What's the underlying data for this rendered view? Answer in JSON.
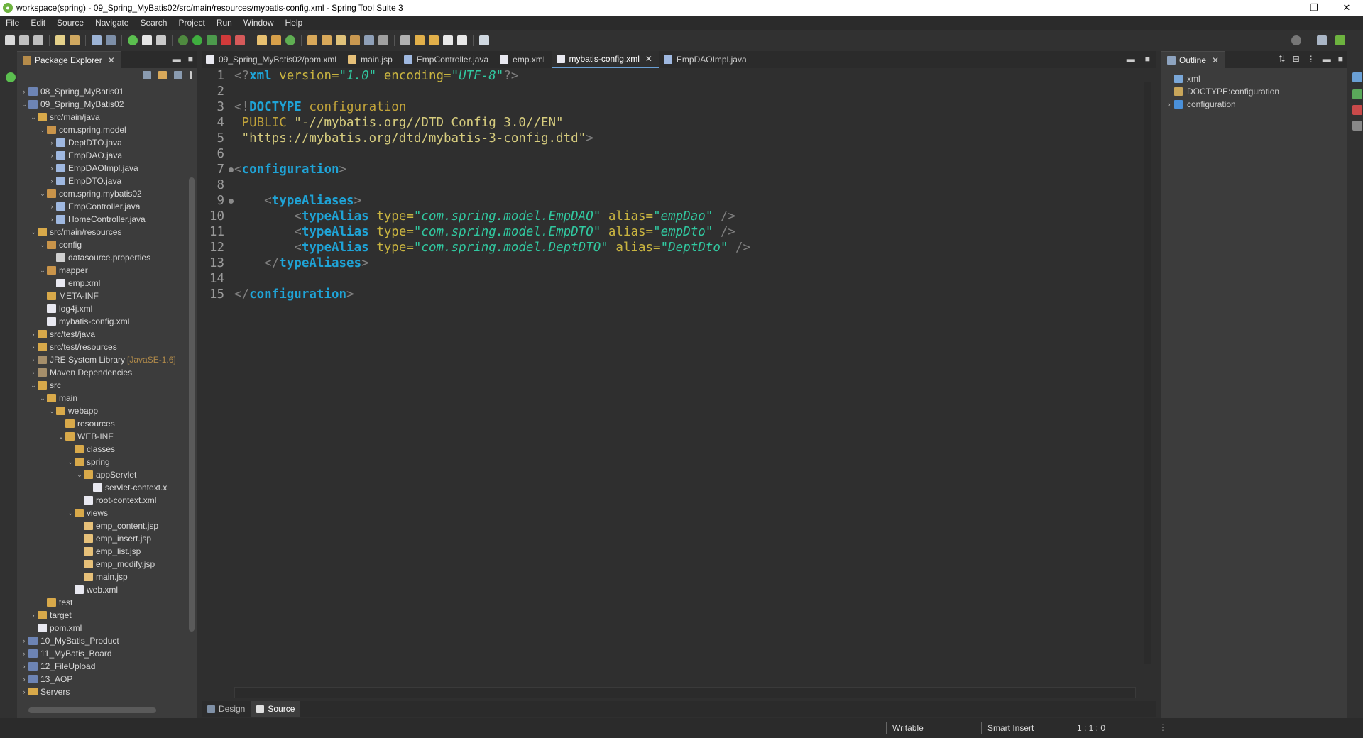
{
  "window": {
    "title": "workspace(spring) - 09_Spring_MyBatis02/src/main/resources/mybatis-config.xml - Spring Tool Suite 3",
    "controls": [
      "—",
      "❐",
      "✕"
    ]
  },
  "menu": [
    "File",
    "Edit",
    "Source",
    "Navigate",
    "Search",
    "Project",
    "Run",
    "Window",
    "Help"
  ],
  "package_explorer": {
    "title": "Package Explorer",
    "tree": [
      {
        "label": "08_Spring_MyBatis01",
        "depth": 0,
        "arrow": "›",
        "icon": "project"
      },
      {
        "label": "09_Spring_MyBatis02",
        "depth": 0,
        "arrow": "⌄",
        "icon": "project"
      },
      {
        "label": "src/main/java",
        "depth": 1,
        "arrow": "⌄",
        "icon": "folder"
      },
      {
        "label": "com.spring.model",
        "depth": 2,
        "arrow": "⌄",
        "icon": "pkg"
      },
      {
        "label": "DeptDTO.java",
        "depth": 3,
        "arrow": "›",
        "icon": "java"
      },
      {
        "label": "EmpDAO.java",
        "depth": 3,
        "arrow": "›",
        "icon": "java"
      },
      {
        "label": "EmpDAOImpl.java",
        "depth": 3,
        "arrow": "›",
        "icon": "java"
      },
      {
        "label": "EmpDTO.java",
        "depth": 3,
        "arrow": "›",
        "icon": "java"
      },
      {
        "label": "com.spring.mybatis02",
        "depth": 2,
        "arrow": "⌄",
        "icon": "pkg"
      },
      {
        "label": "EmpController.java",
        "depth": 3,
        "arrow": "›",
        "icon": "java"
      },
      {
        "label": "HomeController.java",
        "depth": 3,
        "arrow": "›",
        "icon": "java"
      },
      {
        "label": "src/main/resources",
        "depth": 1,
        "arrow": "⌄",
        "icon": "folder"
      },
      {
        "label": "config",
        "depth": 2,
        "arrow": "⌄",
        "icon": "pkg"
      },
      {
        "label": "datasource.properties",
        "depth": 3,
        "arrow": "",
        "icon": "file"
      },
      {
        "label": "mapper",
        "depth": 2,
        "arrow": "⌄",
        "icon": "pkg"
      },
      {
        "label": "emp.xml",
        "depth": 3,
        "arrow": "",
        "icon": "xml"
      },
      {
        "label": "META-INF",
        "depth": 2,
        "arrow": "",
        "icon": "folder"
      },
      {
        "label": "log4j.xml",
        "depth": 2,
        "arrow": "",
        "icon": "xml"
      },
      {
        "label": "mybatis-config.xml",
        "depth": 2,
        "arrow": "",
        "icon": "xml"
      },
      {
        "label": "src/test/java",
        "depth": 1,
        "arrow": "›",
        "icon": "folder"
      },
      {
        "label": "src/test/resources",
        "depth": 1,
        "arrow": "›",
        "icon": "folder"
      },
      {
        "label": "JRE System Library",
        "depth": 1,
        "arrow": "›",
        "icon": "lib",
        "decoration": "[JavaSE-1.6]"
      },
      {
        "label": "Maven Dependencies",
        "depth": 1,
        "arrow": "›",
        "icon": "lib"
      },
      {
        "label": "src",
        "depth": 1,
        "arrow": "⌄",
        "icon": "folder"
      },
      {
        "label": "main",
        "depth": 2,
        "arrow": "⌄",
        "icon": "folder"
      },
      {
        "label": "webapp",
        "depth": 3,
        "arrow": "⌄",
        "icon": "folder"
      },
      {
        "label": "resources",
        "depth": 4,
        "arrow": "",
        "icon": "folder"
      },
      {
        "label": "WEB-INF",
        "depth": 4,
        "arrow": "⌄",
        "icon": "folder"
      },
      {
        "label": "classes",
        "depth": 5,
        "arrow": "",
        "icon": "folder"
      },
      {
        "label": "spring",
        "depth": 5,
        "arrow": "⌄",
        "icon": "folder"
      },
      {
        "label": "appServlet",
        "depth": 6,
        "arrow": "⌄",
        "icon": "folder"
      },
      {
        "label": "servlet-context.x",
        "depth": 7,
        "arrow": "",
        "icon": "xml"
      },
      {
        "label": "root-context.xml",
        "depth": 6,
        "arrow": "",
        "icon": "xml"
      },
      {
        "label": "views",
        "depth": 5,
        "arrow": "⌄",
        "icon": "folder"
      },
      {
        "label": "emp_content.jsp",
        "depth": 6,
        "arrow": "",
        "icon": "jsp"
      },
      {
        "label": "emp_insert.jsp",
        "depth": 6,
        "arrow": "",
        "icon": "jsp"
      },
      {
        "label": "emp_list.jsp",
        "depth": 6,
        "arrow": "",
        "icon": "jsp"
      },
      {
        "label": "emp_modify.jsp",
        "depth": 6,
        "arrow": "",
        "icon": "jsp"
      },
      {
        "label": "main.jsp",
        "depth": 6,
        "arrow": "",
        "icon": "jsp"
      },
      {
        "label": "web.xml",
        "depth": 5,
        "arrow": "",
        "icon": "xml"
      },
      {
        "label": "test",
        "depth": 2,
        "arrow": "",
        "icon": "folder"
      },
      {
        "label": "target",
        "depth": 1,
        "arrow": "›",
        "icon": "folder"
      },
      {
        "label": "pom.xml",
        "depth": 1,
        "arrow": "",
        "icon": "xml"
      },
      {
        "label": "10_MyBatis_Product",
        "depth": 0,
        "arrow": "›",
        "icon": "project"
      },
      {
        "label": "11_MyBatis_Board",
        "depth": 0,
        "arrow": "›",
        "icon": "project"
      },
      {
        "label": "12_FileUpload",
        "depth": 0,
        "arrow": "›",
        "icon": "project"
      },
      {
        "label": "13_AOP",
        "depth": 0,
        "arrow": "›",
        "icon": "project"
      },
      {
        "label": "Servers",
        "depth": 0,
        "arrow": "›",
        "icon": "folder"
      }
    ]
  },
  "editor_tabs": [
    {
      "label": "09_Spring_MyBatis02/pom.xml",
      "icon": "xml",
      "active": false
    },
    {
      "label": "main.jsp",
      "icon": "jsp",
      "active": false
    },
    {
      "label": "EmpController.java",
      "icon": "java",
      "active": false
    },
    {
      "label": "emp.xml",
      "icon": "xml",
      "active": false
    },
    {
      "label": "mybatis-config.xml",
      "icon": "xml",
      "active": true
    },
    {
      "label": "EmpDAOImpl.java",
      "icon": "java",
      "active": false
    }
  ],
  "editor": {
    "line_numbers": [
      "1",
      "2",
      "3",
      "4",
      "5",
      "6",
      "7",
      "8",
      "9",
      "10",
      "11",
      "12",
      "13",
      "14",
      "15"
    ],
    "folds": [
      7,
      9
    ],
    "lines": [
      [
        [
          "c-br",
          "<?"
        ],
        [
          "c-tag",
          "xml"
        ],
        [
          "c-attr",
          " version="
        ],
        [
          "c-val",
          "\"1.0\""
        ],
        [
          "c-attr",
          " encoding="
        ],
        [
          "c-val",
          "\"UTF-8\""
        ],
        [
          "c-br",
          "?>"
        ]
      ],
      [],
      [
        [
          "c-br",
          "<!"
        ],
        [
          "c-tag",
          "DOCTYPE"
        ],
        [
          "c-dt",
          " configuration"
        ]
      ],
      [
        [
          "c-dt",
          " PUBLIC "
        ],
        [
          "c-str",
          "\"-//mybatis.org//DTD Config 3.0//EN\""
        ]
      ],
      [
        [
          "c-str",
          " \"https://mybatis.org/dtd/mybatis-3-config.dtd\""
        ],
        [
          "c-br",
          ">"
        ]
      ],
      [],
      [
        [
          "c-br",
          "<"
        ],
        [
          "c-tag",
          "configuration"
        ],
        [
          "c-br",
          ">"
        ]
      ],
      [],
      [
        [
          "",
          "    "
        ],
        [
          "c-br",
          "<"
        ],
        [
          "c-tag",
          "typeAliases"
        ],
        [
          "c-br",
          ">"
        ]
      ],
      [
        [
          "",
          "        "
        ],
        [
          "c-br",
          "<"
        ],
        [
          "c-tag",
          "typeAlias"
        ],
        [
          "c-attr",
          " type="
        ],
        [
          "c-val",
          "\"com.spring.model.EmpDAO\""
        ],
        [
          "c-attr",
          " alias="
        ],
        [
          "c-val",
          "\"empDao\""
        ],
        [
          "c-br",
          " />"
        ]
      ],
      [
        [
          "",
          "        "
        ],
        [
          "c-br",
          "<"
        ],
        [
          "c-tag",
          "typeAlias"
        ],
        [
          "c-attr",
          " type="
        ],
        [
          "c-val",
          "\"com.spring.model.EmpDTO\""
        ],
        [
          "c-attr",
          " alias="
        ],
        [
          "c-val",
          "\"empDto\""
        ],
        [
          "c-br",
          " />"
        ]
      ],
      [
        [
          "",
          "        "
        ],
        [
          "c-br",
          "<"
        ],
        [
          "c-tag",
          "typeAlias"
        ],
        [
          "c-attr",
          " type="
        ],
        [
          "c-val",
          "\"com.spring.model.DeptDTO\""
        ],
        [
          "c-attr",
          " alias="
        ],
        [
          "c-val",
          "\"DeptDto\""
        ],
        [
          "c-br",
          " />"
        ]
      ],
      [
        [
          "",
          "    "
        ],
        [
          "c-br",
          "</"
        ],
        [
          "c-tag",
          "typeAliases"
        ],
        [
          "c-br",
          ">"
        ]
      ],
      [],
      [
        [
          "c-br",
          "</"
        ],
        [
          "c-tag",
          "configuration"
        ],
        [
          "c-br",
          ">"
        ]
      ]
    ]
  },
  "bottom_tabs": [
    {
      "label": "Design",
      "active": false
    },
    {
      "label": "Source",
      "active": true
    }
  ],
  "outline": {
    "title": "Outline",
    "items": [
      {
        "label": "xml",
        "arrow": "",
        "icon_color": "#7aa7d8"
      },
      {
        "label": "DOCTYPE:configuration",
        "arrow": "",
        "icon_color": "#c9a65a"
      },
      {
        "label": "configuration",
        "arrow": "›",
        "icon_color": "#4a90d9"
      }
    ]
  },
  "status": {
    "writable": "Writable",
    "insert_mode": "Smart Insert",
    "position": "1 : 1 : 0"
  }
}
